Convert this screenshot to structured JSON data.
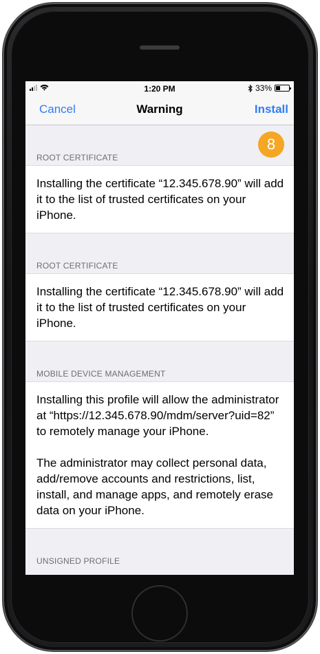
{
  "status_bar": {
    "time": "1:20 PM",
    "battery_percent": "33%",
    "battery_level": 0.33,
    "signal_bars_active": 2,
    "signal_bars_total": 4
  },
  "nav": {
    "cancel_label": "Cancel",
    "title": "Warning",
    "install_label": "Install"
  },
  "step_badge": "8",
  "sections": [
    {
      "header": "ROOT CERTIFICATE",
      "paragraphs": [
        "Installing the certificate “12.345.678.90” will add it to the list of trusted certificates on your iPhone."
      ]
    },
    {
      "header": "ROOT CERTIFICATE",
      "paragraphs": [
        "Installing the certificate “12.345.678.90” will add it to the list of trusted certificates on your iPhone."
      ]
    },
    {
      "header": "MOBILE DEVICE MANAGEMENT",
      "paragraphs": [
        "Installing this profile will allow the administrator at “https://12.345.678.90/mdm/server?uid=82” to remotely manage your iPhone.",
        "The administrator may collect personal data, add/remove accounts and restrictions, list, install, and manage apps, and remotely erase data on your iPhone."
      ]
    },
    {
      "header": "UNSIGNED PROFILE",
      "paragraphs": []
    }
  ],
  "colors": {
    "accent": "#2f7cf6",
    "badge": "#f5a623",
    "group_background": "#efeff4"
  }
}
